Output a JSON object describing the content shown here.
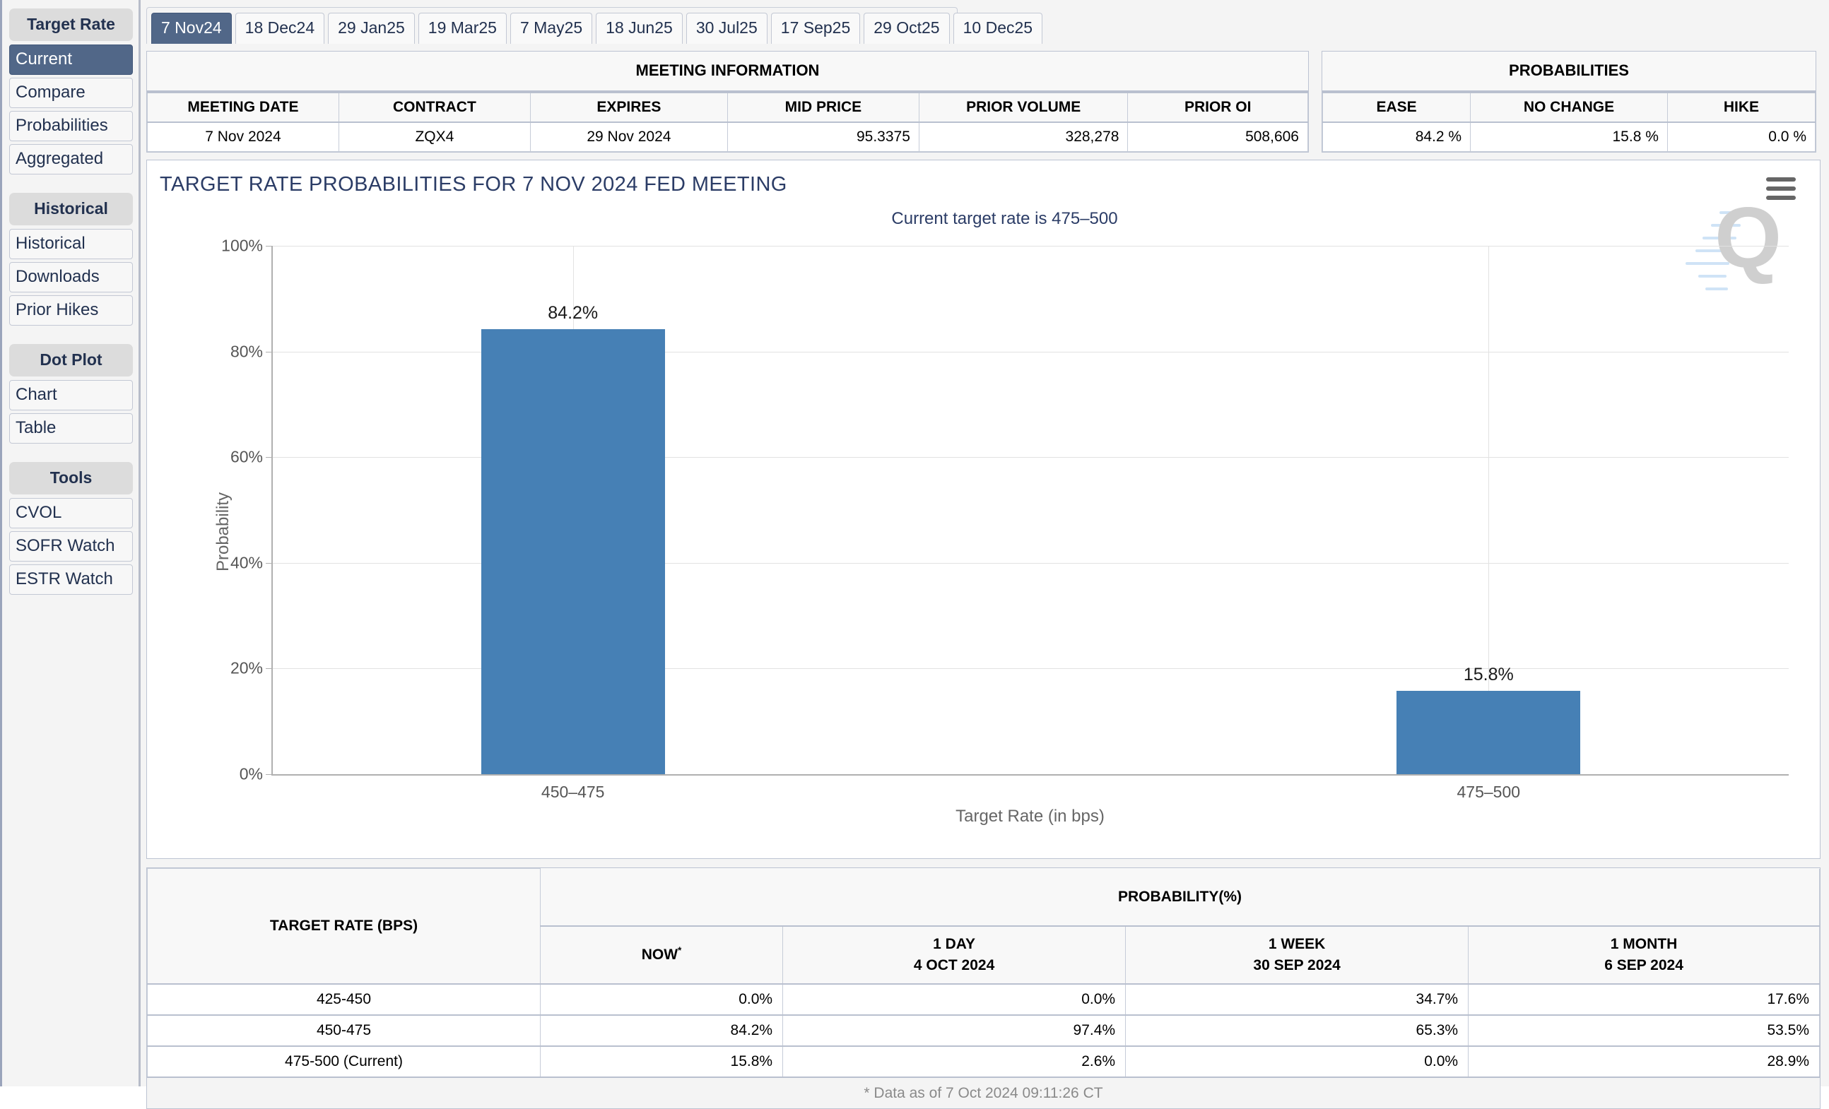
{
  "sidebar": {
    "groups": [
      {
        "title": "Target Rate",
        "items": [
          {
            "label": "Current",
            "active": true
          },
          {
            "label": "Compare",
            "active": false
          },
          {
            "label": "Probabilities",
            "active": false
          },
          {
            "label": "Aggregated",
            "active": false
          }
        ]
      },
      {
        "title": "Historical",
        "items": [
          {
            "label": "Historical",
            "active": false
          },
          {
            "label": "Downloads",
            "active": false
          },
          {
            "label": "Prior Hikes",
            "active": false
          }
        ]
      },
      {
        "title": "Dot Plot",
        "items": [
          {
            "label": "Chart",
            "active": false
          },
          {
            "label": "Table",
            "active": false
          }
        ]
      },
      {
        "title": "Tools",
        "items": [
          {
            "label": "CVOL",
            "active": false
          },
          {
            "label": "SOFR Watch",
            "active": false
          },
          {
            "label": "ESTR Watch",
            "active": false
          }
        ]
      }
    ]
  },
  "tabs": [
    {
      "label": "7 Nov24",
      "active": true
    },
    {
      "label": "18 Dec24",
      "active": false
    },
    {
      "label": "29 Jan25",
      "active": false
    },
    {
      "label": "19 Mar25",
      "active": false
    },
    {
      "label": "7 May25",
      "active": false
    },
    {
      "label": "18 Jun25",
      "active": false
    },
    {
      "label": "30 Jul25",
      "active": false
    },
    {
      "label": "17 Sep25",
      "active": false
    },
    {
      "label": "29 Oct25",
      "active": false
    },
    {
      "label": "10 Dec25",
      "active": false
    }
  ],
  "meeting_information": {
    "caption": "MEETING INFORMATION",
    "headers": [
      "MEETING DATE",
      "CONTRACT",
      "EXPIRES",
      "MID PRICE",
      "PRIOR VOLUME",
      "PRIOR OI"
    ],
    "row": {
      "meeting_date": "7 Nov 2024",
      "contract": "ZQX4",
      "expires": "29 Nov 2024",
      "mid_price": "95.3375",
      "prior_volume": "328,278",
      "prior_oi": "508,606"
    }
  },
  "probabilities": {
    "caption": "PROBABILITIES",
    "headers": [
      "EASE",
      "NO CHANGE",
      "HIKE"
    ],
    "row": {
      "ease": "84.2 %",
      "no_change": "15.8 %",
      "hike": "0.0 %"
    }
  },
  "chart": {
    "title": "TARGET RATE PROBABILITIES FOR 7 NOV 2024 FED MEETING",
    "subtitle": "Current target rate is 475–500",
    "menu_icon": "hamburger-icon",
    "watermark_letter": "Q",
    "bar_color": "#4680b5"
  },
  "chart_data": {
    "type": "bar",
    "title": "TARGET RATE PROBABILITIES FOR 7 NOV 2024 FED MEETING",
    "subtitle": "Current target rate is 475–500",
    "xlabel": "Target Rate (in bps)",
    "ylabel": "Probability",
    "categories": [
      "450–475",
      "475–500"
    ],
    "values": [
      84.2,
      15.8
    ],
    "data_labels": [
      "84.2%",
      "15.8%"
    ],
    "ylim": [
      0,
      100
    ],
    "yticks": [
      0,
      20,
      40,
      60,
      80,
      100
    ],
    "ytick_labels": [
      "0%",
      "20%",
      "40%",
      "60%",
      "80%",
      "100%"
    ],
    "grid": true,
    "legend": "none"
  },
  "bottom_table": {
    "col1_header": "TARGET RATE (BPS)",
    "group_header": "PROBABILITY(%)",
    "subheaders": [
      {
        "line1": "NOW",
        "line2": "",
        "star": "*"
      },
      {
        "line1": "1 DAY",
        "line2": "4 OCT 2024",
        "star": ""
      },
      {
        "line1": "1 WEEK",
        "line2": "30 SEP 2024",
        "star": ""
      },
      {
        "line1": "1 MONTH",
        "line2": "6 SEP 2024",
        "star": ""
      }
    ],
    "rows": [
      {
        "rate": "425-450",
        "now": "0.0%",
        "day1": "0.0%",
        "week1": "34.7%",
        "month1": "17.6%"
      },
      {
        "rate": "450-475",
        "now": "84.2%",
        "day1": "97.4%",
        "week1": "65.3%",
        "month1": "53.5%"
      },
      {
        "rate": "475-500 (Current)",
        "now": "15.8%",
        "day1": "2.6%",
        "week1": "0.0%",
        "month1": "28.9%"
      }
    ],
    "footnote": "* Data as of 7 Oct 2024 09:11:26 CT"
  }
}
